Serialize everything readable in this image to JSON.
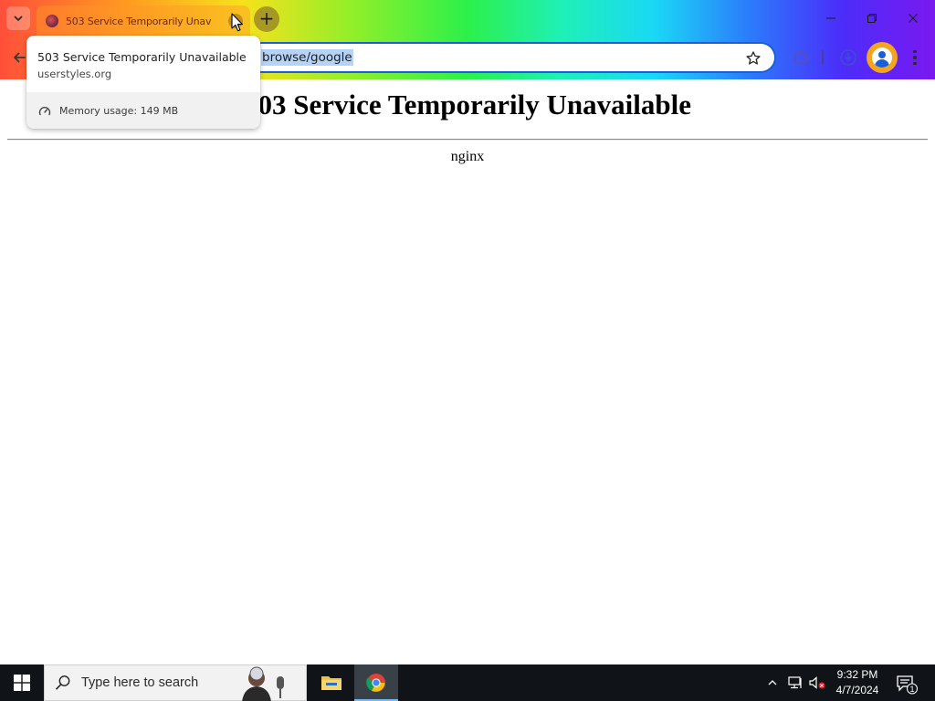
{
  "browser": {
    "tab": {
      "title": "503 Service Temporarily Unava"
    },
    "omnibox": {
      "url_visible": "browse/google"
    }
  },
  "hover_card": {
    "title": "503 Service Temporarily Unavailable",
    "domain": "userstyles.org",
    "memory": "Memory usage: 149 MB"
  },
  "page": {
    "heading": "503 Service Temporarily Unavailable",
    "server": "nginx"
  },
  "taskbar": {
    "search_placeholder": "Type here to search",
    "clock_time": "9:32 PM",
    "clock_date": "4/7/2024",
    "notification_count": "1"
  },
  "colors": {
    "omnibox_focus": "#1a5fd8",
    "selection": "#b5d3f7",
    "profile": "#f4a520",
    "taskbar": "#101418"
  }
}
